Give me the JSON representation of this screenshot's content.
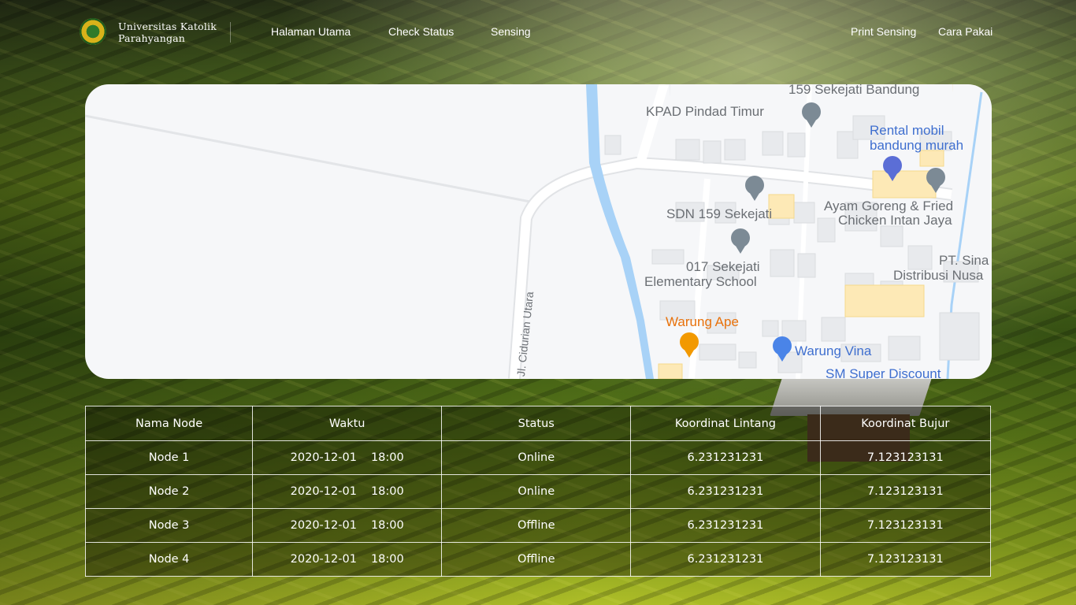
{
  "header": {
    "brand_line1": "Universitas Katolik",
    "brand_line2": "Parahyangan",
    "nav": [
      {
        "label": "Halaman Utama"
      },
      {
        "label": "Check Status"
      },
      {
        "label": "Sensing"
      },
      {
        "label": "Print Sensing"
      },
      {
        "label": "Cara Pakai"
      }
    ]
  },
  "map": {
    "places": [
      {
        "name": "159 Sekejati Bandung"
      },
      {
        "name": "KPAD Pindad Timur"
      },
      {
        "name": "Rental mobil bandung murah"
      },
      {
        "name": "SDN 159 Sekejati"
      },
      {
        "name": "Ayam Goreng & Fried Chicken Intan Jaya"
      },
      {
        "name": "017 Sekejati Elementary School"
      },
      {
        "name": "PT. Sina Distribusi Nusa"
      },
      {
        "name": "Warung Ape"
      },
      {
        "name": "Warung Vina"
      },
      {
        "name": "SM Super Discount"
      }
    ],
    "labels": {
      "sekejati_bandung": "159 Sekejati Bandung",
      "kpad": "KPAD Pindad Timur",
      "rental_1": "Rental mobil",
      "rental_2": "bandung murah",
      "sdn": "SDN 159 Sekejati",
      "ayam_1": "Ayam Goreng & Fried",
      "ayam_2": "Chicken Intan Jaya",
      "sd017_1": "017 Sekejati",
      "sd017_2": "Elementary School",
      "pt_1": "PT. Sina",
      "pt_2": "Distribusi Nusa",
      "warung_ape": "Warung Ape",
      "warung_vina": "Warung Vina",
      "sm_super": "SM Super Discount",
      "road": "Jl. Cidurian Utara"
    }
  },
  "table": {
    "headers": [
      "Nama Node",
      "Waktu",
      "Status",
      "Koordinat Lintang",
      "Koordinat Bujur"
    ],
    "rows": [
      {
        "node": "Node 1",
        "date": "2020-12-01",
        "time": "18:00",
        "status": "Online",
        "lat": "6.231231231",
        "lon": "7.123123131"
      },
      {
        "node": "Node 2",
        "date": "2020-12-01",
        "time": "18:00",
        "status": "Online",
        "lat": "6.231231231",
        "lon": "7.123123131"
      },
      {
        "node": "Node 3",
        "date": "2020-12-01",
        "time": "18:00",
        "status": "Offline",
        "lat": "6.231231231",
        "lon": "7.123123131"
      },
      {
        "node": "Node 4",
        "date": "2020-12-01",
        "time": "18:00",
        "status": "Offline",
        "lat": "6.231231231",
        "lon": "7.123123131"
      }
    ]
  },
  "colors": {
    "water": "#a8d2f7",
    "road": "#ffffff",
    "building": "#e8eaed",
    "pin_gray": "#7c8a95",
    "pin_orange": "#f29900",
    "pin_blue": "#4a84e8"
  }
}
